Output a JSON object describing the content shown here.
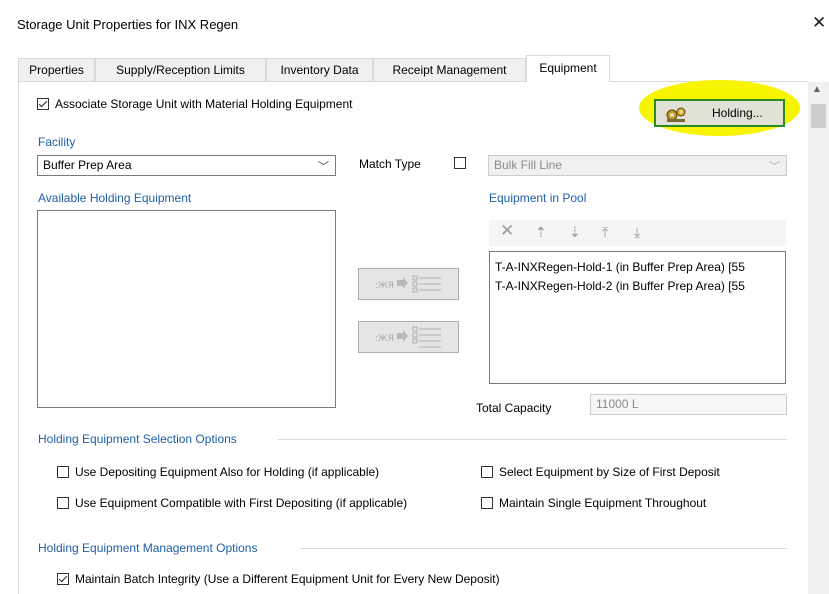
{
  "window": {
    "title": "Storage Unit Properties for INX Regen",
    "close_glyph": "✕"
  },
  "tabs": [
    {
      "label": "Properties",
      "active": false
    },
    {
      "label": "Supply/Reception Limits",
      "active": false
    },
    {
      "label": "Inventory Data",
      "active": false
    },
    {
      "label": "Receipt Management",
      "active": false
    },
    {
      "label": "Equipment",
      "active": true
    }
  ],
  "equipment": {
    "associate_label": "Associate Storage Unit with Material Holding Equipment",
    "associate_checked": true,
    "holding_button_label": "Holding...",
    "holding_button_icon": "gear-group-icon",
    "facility_label": "Facility",
    "facility_value": "Buffer Prep Area",
    "match_type_label": "Match Type",
    "match_type_checked": false,
    "match_type_value": "Bulk Fill Line",
    "available_label": "Available Holding Equipment",
    "available_items": [],
    "pool_label": "Equipment in Pool",
    "pool_toolbar": [
      "remove-icon",
      "move-up-icon",
      "move-down-icon",
      "move-top-icon",
      "move-bottom-icon"
    ],
    "pool_items": [
      "T-A-INXRegen-Hold-1 (in Buffer Prep Area) [55",
      "T-A-INXRegen-Hold-2 (in Buffer Prep Area) [55"
    ],
    "add_button_text": ":ЖЯ➜",
    "add_all_button_text": ":ЖЯ➜",
    "total_capacity_label": "Total Capacity",
    "total_capacity_value": "11000 L"
  },
  "selection_options": {
    "header": "Holding Equipment Selection Options",
    "items": [
      {
        "label": "Use Depositing Equipment Also for Holding (if applicable)",
        "checked": false
      },
      {
        "label": "Select Equipment by Size of First Deposit",
        "checked": false
      },
      {
        "label": "Use Equipment Compatible with First Depositing (if applicable)",
        "checked": false
      },
      {
        "label": "Maintain Single Equipment Throughout",
        "checked": false
      }
    ]
  },
  "management_options": {
    "header": "Holding Equipment Management Options",
    "items": [
      {
        "label": "Maintain Batch Integrity (Use a Different Equipment Unit for Every New Deposit)",
        "checked": true
      }
    ]
  },
  "colors": {
    "section_header": "#1f5fa8",
    "highlight": "#f7f500",
    "holding_border": "#2d8a20"
  }
}
